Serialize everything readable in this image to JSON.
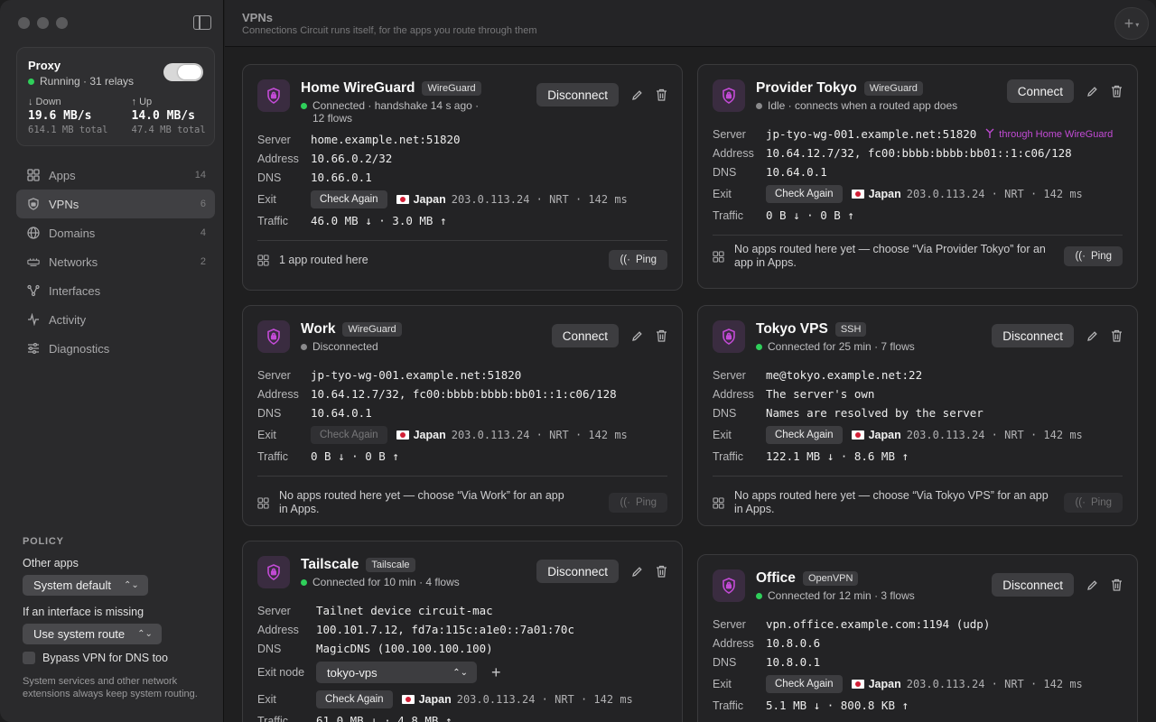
{
  "sidebar": {
    "proxy": {
      "title": "Proxy",
      "status": "Running · 31 relays",
      "down_label": "↓ Down",
      "down_value": "19.6 MB/s",
      "down_total": "614.1 MB total",
      "up_label": "↑ Up",
      "up_value": "14.0 MB/s",
      "up_total": "47.4 MB total"
    },
    "nav": [
      {
        "label": "Apps",
        "count": "14",
        "icon": "apps-grid-icon"
      },
      {
        "label": "VPNs",
        "count": "6",
        "icon": "shield-icon"
      },
      {
        "label": "Domains",
        "count": "4",
        "icon": "globe-icon"
      },
      {
        "label": "Networks",
        "count": "2",
        "icon": "network-icon"
      },
      {
        "label": "Interfaces",
        "count": "",
        "icon": "interfaces-icon"
      },
      {
        "label": "Activity",
        "count": "",
        "icon": "activity-icon"
      },
      {
        "label": "Diagnostics",
        "count": "",
        "icon": "sliders-icon"
      }
    ],
    "policy": {
      "heading": "POLICY",
      "other_apps_label": "Other apps",
      "other_apps_value": "System default",
      "missing_label": "If an interface is missing",
      "missing_value": "Use system route",
      "bypass_label": "Bypass VPN for DNS too",
      "note": "System services and other network extensions always keep system routing."
    }
  },
  "header": {
    "title": "VPNs",
    "subtitle": "Connections Circuit runs itself, for the apps you route through them"
  },
  "labels": {
    "server": "Server",
    "address": "Address",
    "dns": "DNS",
    "exit": "Exit",
    "exit_node": "Exit node",
    "traffic": "Traffic",
    "check_again": "Check Again",
    "ping": "Ping",
    "disconnect": "Disconnect",
    "connect": "Connect",
    "country": "Japan",
    "exit_meta": "203.0.113.24 · NRT · 142 ms"
  },
  "cards": {
    "home": {
      "title": "Home WireGuard",
      "badge": "WireGuard",
      "status": "Connected · handshake 14 s ago · 12 flows",
      "server": "home.example.net:51820",
      "address": "10.66.0.2/32",
      "dns": "10.66.0.1",
      "traffic": "46.0 MB ↓ · 3.0 MB ↑",
      "footer": "1 app routed here"
    },
    "provider": {
      "title": "Provider Tokyo",
      "badge": "WireGuard",
      "status": "Idle · connects when a routed app does",
      "server": "jp-tyo-wg-001.example.net:51820",
      "via": "through Home WireGuard",
      "address": "10.64.12.7/32, fc00:bbbb:bbbb:bb01::1:c06/128",
      "dns": "10.64.0.1",
      "traffic": "0 B ↓ · 0 B ↑",
      "footer": "No apps routed here yet — choose “Via Provider Tokyo” for an app in Apps."
    },
    "work": {
      "title": "Work",
      "badge": "WireGuard",
      "status": "Disconnected",
      "server": "jp-tyo-wg-001.example.net:51820",
      "address": "10.64.12.7/32, fc00:bbbb:bbbb:bb01::1:c06/128",
      "dns": "10.64.0.1",
      "traffic": "0 B ↓ · 0 B ↑",
      "footer": "No apps routed here yet — choose “Via Work” for an app in Apps."
    },
    "tokyo": {
      "title": "Tokyo VPS",
      "badge": "SSH",
      "status": "Connected for 25 min · 7 flows",
      "server": "me@tokyo.example.net:22",
      "address": "The server's own",
      "dns": "Names are resolved by the server",
      "traffic": "122.1 MB ↓ · 8.6 MB ↑",
      "footer": "No apps routed here yet — choose “Via Tokyo VPS” for an app in Apps."
    },
    "tailscale": {
      "title": "Tailscale",
      "badge": "Tailscale",
      "status": "Connected for 10 min · 4 flows",
      "server": "Tailnet device circuit-mac",
      "address": "100.101.7.12, fd7a:115c:a1e0::7a01:70c",
      "dns": "MagicDNS (100.100.100.100)",
      "exit_node": "tokyo-vps",
      "traffic": "61.0 MB ↓ · 4.8 MB ↑"
    },
    "office": {
      "title": "Office",
      "badge": "OpenVPN",
      "status": "Connected for 12 min · 3 flows",
      "server": "vpn.office.example.com:1194 (udp)",
      "address": "10.8.0.6",
      "dns": "10.8.0.1",
      "traffic": "5.1 MB ↓ · 800.8 KB ↑"
    }
  },
  "colors": {
    "accent": "#c34bd6",
    "connected": "#2fcf5a",
    "idle": "#8a8a8c"
  }
}
